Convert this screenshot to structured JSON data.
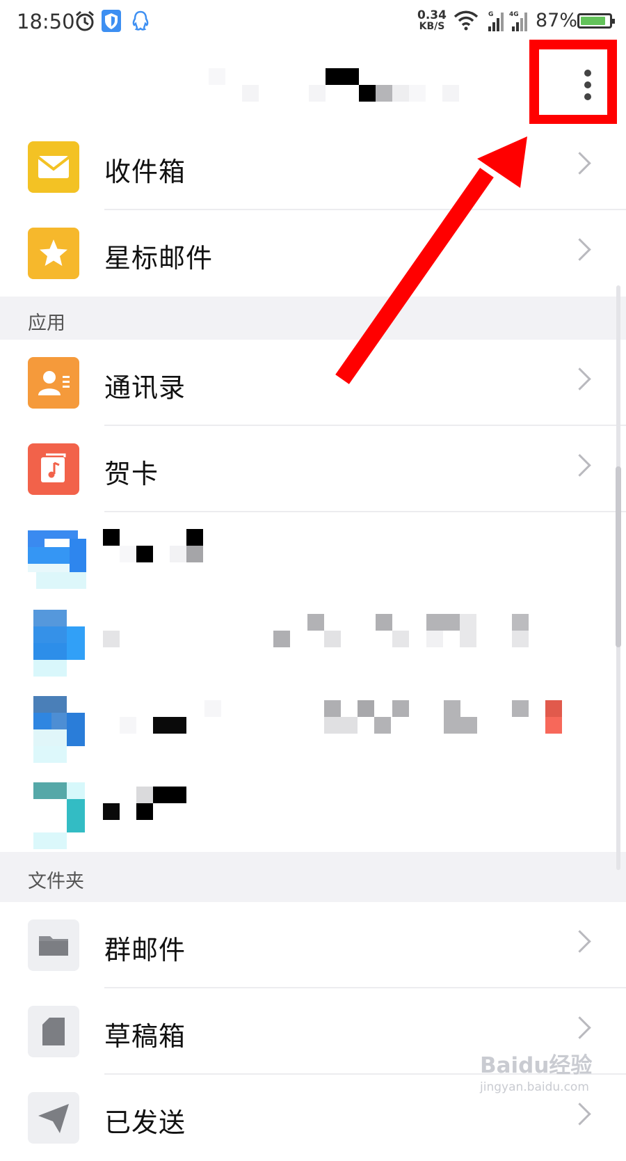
{
  "status_bar": {
    "time": "18:50",
    "net_speed_value": "0.34",
    "net_speed_unit": "KB/S",
    "battery": "87%",
    "battery_level": 0.87,
    "icons": [
      "alarm-icon",
      "shield-icon",
      "qq-icon",
      "wifi-icon",
      "signal-icon",
      "signal-4g-icon"
    ]
  },
  "header": {
    "more_icon": "more-vertical-icon"
  },
  "mailboxes": [
    {
      "label": "收件箱",
      "icon": "envelope-icon",
      "color": "#f3c224"
    },
    {
      "label": "星标邮件",
      "icon": "star-icon",
      "color": "#f6b82c"
    }
  ],
  "apps_section": {
    "title": "应用",
    "items": [
      {
        "label": "通讯录",
        "icon": "contact-card-icon",
        "color": "#f59a3b"
      },
      {
        "label": "贺卡",
        "icon": "music-card-icon",
        "color": "#f2624a"
      }
    ]
  },
  "folders_section": {
    "title": "文件夹",
    "items": [
      {
        "label": "群邮件",
        "icon": "folder-icon",
        "color": "#eeeff2"
      },
      {
        "label": "草稿箱",
        "icon": "document-icon",
        "color": "#eeeff2"
      },
      {
        "label": "已发送",
        "icon": "send-icon",
        "color": "#eeeff2"
      }
    ]
  },
  "watermark": {
    "brand": "Baidu经验",
    "url": "jingyan.baidu.com"
  }
}
